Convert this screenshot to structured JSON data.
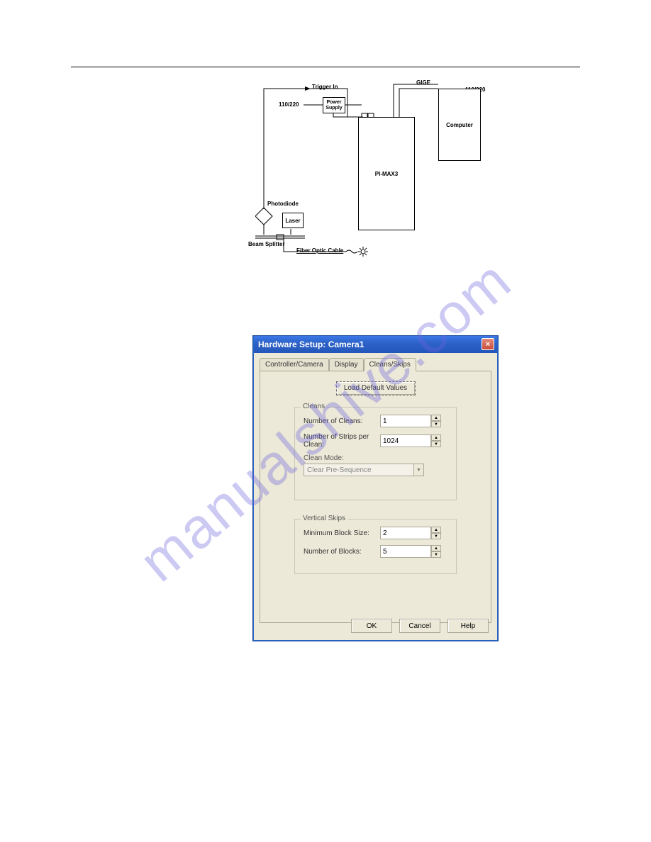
{
  "watermark": "manualshive.com",
  "schematic": {
    "trigger_in": "Trigger In",
    "gige": "GIGE",
    "v110_220_r": "110/220",
    "v110_220_l": "110/220",
    "power_supply": "Power\nSupply",
    "computer": "Computer",
    "pimax3": "PI-MAX3",
    "laser": "Laser",
    "photodiode": "Photodiode",
    "beam_splitter": "Beam Splitter",
    "fiber_optic": "Fiber Optic Cable"
  },
  "dialog": {
    "title": "Hardware Setup: Camera1",
    "tabs": {
      "controller": "Controller/Camera",
      "display": "Display",
      "cleans": "Cleans/Skips"
    },
    "load_defaults": "Load Default Values",
    "cleans_group": {
      "title": "Cleans",
      "num_cleans_label": "Number of Cleans:",
      "num_cleans_value": "1",
      "num_strips_label": "Number of Strips per Clean:",
      "num_strips_value": "1024",
      "clean_mode_label": "Clean Mode:",
      "clean_mode_value": "Clear Pre-Sequence"
    },
    "skips_group": {
      "title": "Vertical Skips",
      "min_block_label": "Minimum Block Size:",
      "min_block_value": "2",
      "num_blocks_label": "Number of Blocks:",
      "num_blocks_value": "5"
    },
    "buttons": {
      "ok": "OK",
      "cancel": "Cancel",
      "help": "Help"
    }
  }
}
